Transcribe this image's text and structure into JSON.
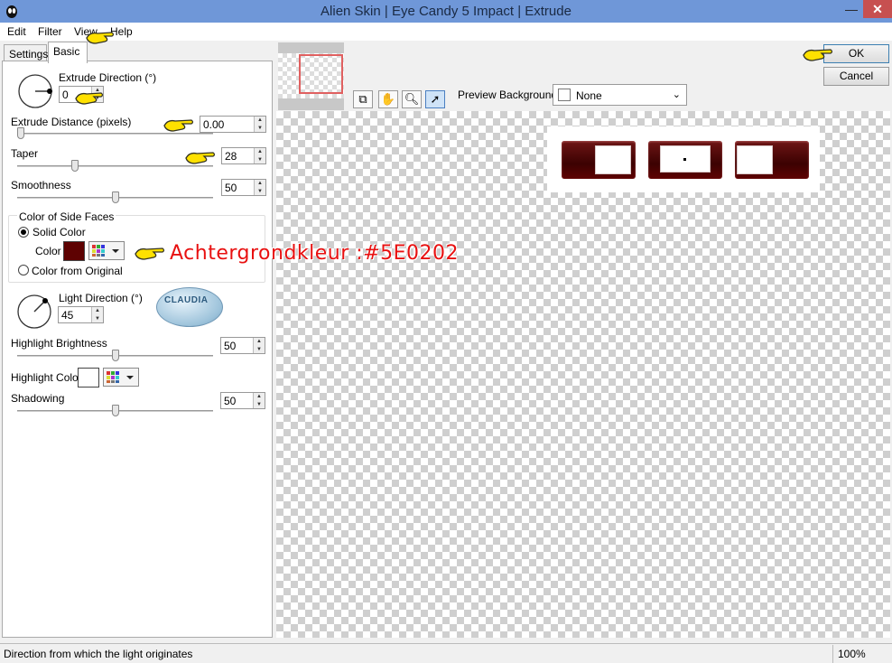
{
  "window": {
    "title": "Alien Skin | Eye Candy 5 Impact | Extrude"
  },
  "menu": {
    "items": [
      "Edit",
      "Filter",
      "View",
      "Help"
    ]
  },
  "tabs": {
    "settings": "Settings",
    "basic": "Basic"
  },
  "panel": {
    "extrude_direction": {
      "label": "Extrude Direction (°)",
      "value": "0"
    },
    "extrude_distance": {
      "label": "Extrude Distance (pixels)",
      "value": "0.00"
    },
    "taper": {
      "label": "Taper",
      "value": "28"
    },
    "smoothness": {
      "label": "Smoothness",
      "value": "50"
    },
    "side_faces": {
      "title": "Color of Side Faces",
      "solid_color": "Solid Color",
      "color_label": "Color",
      "from_original": "Color from Original",
      "color": "#5E0202"
    },
    "light_direction": {
      "label": "Light Direction (°)",
      "value": "45"
    },
    "highlight_brightness": {
      "label": "Highlight Brightness",
      "value": "50"
    },
    "highlight_color": {
      "label": "Highlight Color",
      "color": "#FFFFFF"
    },
    "shadowing": {
      "label": "Shadowing",
      "value": "50"
    }
  },
  "toolbar": {
    "preview_background_label": "Preview Background:",
    "preview_background_value": "None"
  },
  "buttons": {
    "ok": "OK",
    "cancel": "Cancel"
  },
  "annotation": {
    "text": "Achtergrondkleur :#5E0202"
  },
  "watermark": {
    "text": "CLAUDIA"
  },
  "status": {
    "text": "Direction from which the light originates",
    "zoom": "100%"
  }
}
